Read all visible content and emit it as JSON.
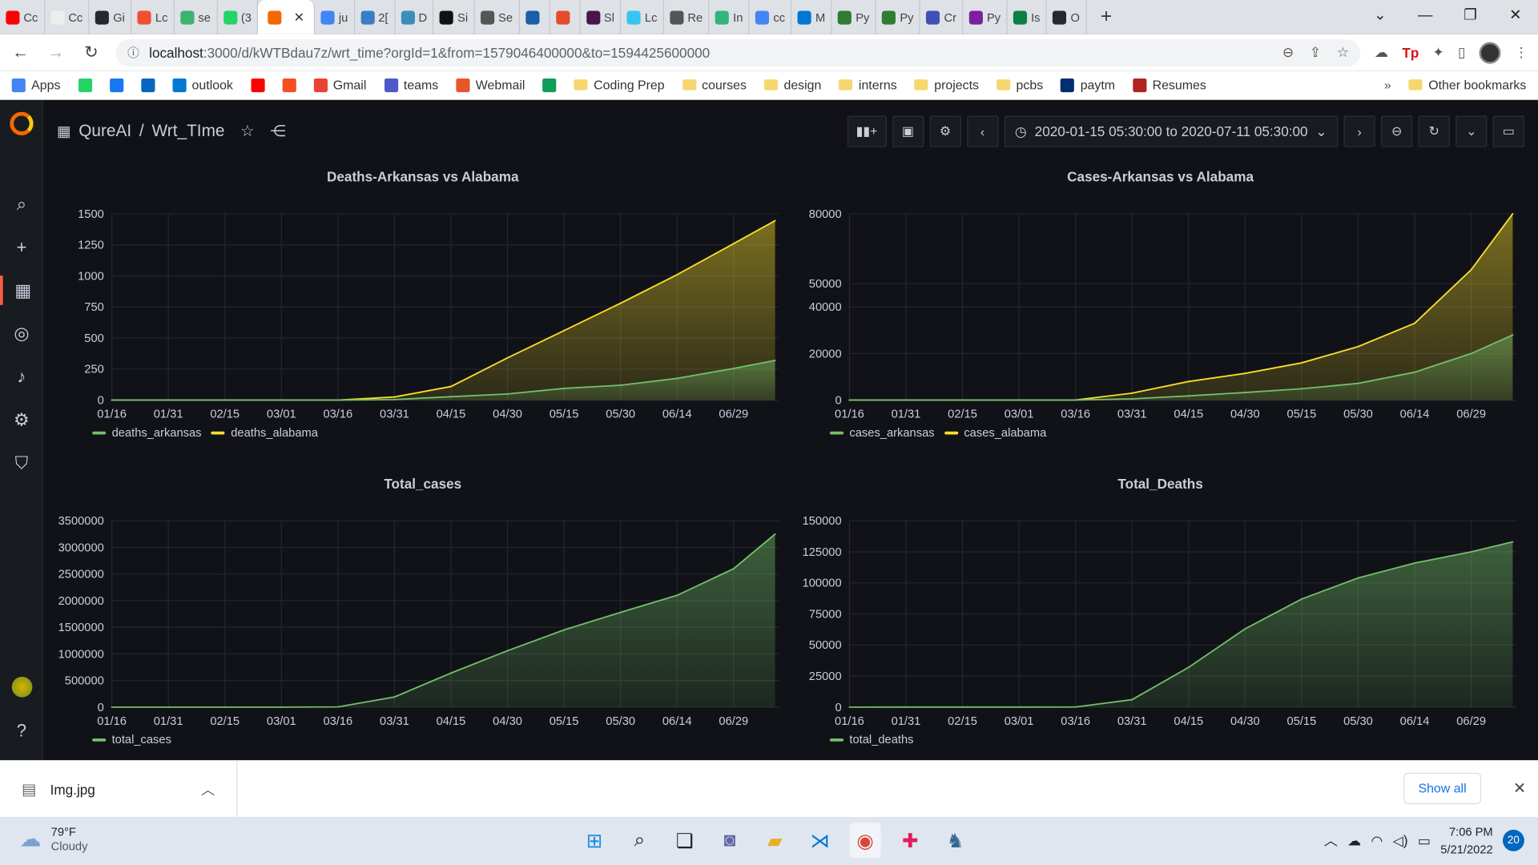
{
  "browser": {
    "tabs": [
      {
        "label": "Cc",
        "color": "#ff0000"
      },
      {
        "label": "Cc",
        "color": "#eeeeee"
      },
      {
        "label": "Gi",
        "color": "#24292e"
      },
      {
        "label": "Lc",
        "color": "#f05032"
      },
      {
        "label": "se",
        "color": "#3cb371"
      },
      {
        "label": "(3",
        "color": "#25d366"
      },
      {
        "label": "",
        "color": "#f46800",
        "active": true
      },
      {
        "label": "ju",
        "color": "#4285f4"
      },
      {
        "label": "2[",
        "color": "#3b7dc4"
      },
      {
        "label": "D",
        "color": "#3c8dbc"
      },
      {
        "label": "Si",
        "color": "#111111"
      },
      {
        "label": "Se",
        "color": "#555555"
      },
      {
        "label": "",
        "color": "#1a5da8"
      },
      {
        "label": "",
        "color": "#e54b2a"
      },
      {
        "label": "Sl",
        "color": "#4a154b"
      },
      {
        "label": "Lc",
        "color": "#36c5f0"
      },
      {
        "label": "Re",
        "color": "#555555"
      },
      {
        "label": "In",
        "color": "#2eb67d"
      },
      {
        "label": "cc",
        "color": "#4285f4"
      },
      {
        "label": "M",
        "color": "#0078d4"
      },
      {
        "label": "Py",
        "color": "#2e7d32"
      },
      {
        "label": "Py",
        "color": "#2e7d32"
      },
      {
        "label": "Cr",
        "color": "#3f51b5"
      },
      {
        "label": "Py",
        "color": "#7b1fa2"
      },
      {
        "label": "Is",
        "color": "#0b8043"
      },
      {
        "label": "O",
        "color": "#24292e"
      }
    ],
    "url_host": "localhost",
    "url_rest": ":3000/d/kWTBdau7z/wrt_time?orgId=1&from=1579046400000&to=1594425600000"
  },
  "bookmarks": [
    {
      "label": "Apps",
      "icon": "apps-grid",
      "color": "#4285f4"
    },
    {
      "label": "",
      "icon": "whatsapp",
      "color": "#25d366"
    },
    {
      "label": "",
      "icon": "facebook",
      "color": "#1877f2"
    },
    {
      "label": "",
      "icon": "linkedin",
      "color": "#0a66c2"
    },
    {
      "label": "outlook",
      "icon": "outlook",
      "color": "#0078d4"
    },
    {
      "label": "",
      "icon": "youtube",
      "color": "#ff0000"
    },
    {
      "label": "",
      "icon": "microsoft",
      "color": "#f25022"
    },
    {
      "label": "Gmail",
      "icon": "gmail",
      "color": "#ea4335"
    },
    {
      "label": "teams",
      "icon": "teams",
      "color": "#5059c9"
    },
    {
      "label": "Webmail",
      "icon": "webmail",
      "color": "#e8572a"
    },
    {
      "label": "",
      "icon": "drive",
      "color": "#0f9d58"
    },
    {
      "label": "Coding Prep",
      "icon": "folder"
    },
    {
      "label": "courses",
      "icon": "folder"
    },
    {
      "label": "design",
      "icon": "folder"
    },
    {
      "label": "interns",
      "icon": "folder"
    },
    {
      "label": "projects",
      "icon": "folder"
    },
    {
      "label": "pcbs",
      "icon": "folder"
    },
    {
      "label": "paytm",
      "icon": "paytm",
      "color": "#002e6e"
    },
    {
      "label": "Resumes",
      "icon": "resumes",
      "color": "#b22222"
    }
  ],
  "bookmarks_more": "»",
  "other_bookmarks": "Other bookmarks",
  "grafana": {
    "org": "QureAI",
    "separator": "/",
    "dashboard": "Wrt_TIme",
    "time_range": "2020-01-15 05:30:00 to 2020-07-11 05:30:00"
  },
  "x_ticks": [
    "01/16",
    "01/31",
    "02/15",
    "03/01",
    "03/16",
    "03/31",
    "04/15",
    "04/30",
    "05/15",
    "05/30",
    "06/14",
    "06/29"
  ],
  "chart_data": [
    {
      "type": "area",
      "title": "Deaths-Arkansas vs Alabama",
      "x_start": "01/16",
      "x_end": "07/11",
      "ylim": [
        0,
        1500
      ],
      "y_ticks": [
        0,
        250,
        500,
        750,
        1000,
        1250,
        1500
      ],
      "stacked": true,
      "legend_placement": "bottom-left",
      "series": [
        {
          "name": "deaths_arkansas",
          "color": "#73bf69",
          "points": [
            [
              "01/16",
              0
            ],
            [
              "03/16",
              0
            ],
            [
              "03/31",
              5
            ],
            [
              "04/15",
              28
            ],
            [
              "04/30",
              50
            ],
            [
              "05/15",
              95
            ],
            [
              "05/30",
              120
            ],
            [
              "06/14",
              175
            ],
            [
              "06/29",
              255
            ],
            [
              "07/10",
              320
            ]
          ]
        },
        {
          "name": "deaths_alabama",
          "color": "#fade2a",
          "points": [
            [
              "01/16",
              0
            ],
            [
              "03/16",
              0
            ],
            [
              "03/31",
              25
            ],
            [
              "04/15",
              110
            ],
            [
              "04/30",
              340
            ],
            [
              "05/15",
              560
            ],
            [
              "05/30",
              780
            ],
            [
              "06/14",
              1010
            ],
            [
              "06/29",
              1260
            ],
            [
              "07/10",
              1445
            ]
          ]
        }
      ]
    },
    {
      "type": "area",
      "title": "Cases-Arkansas vs Alabama",
      "x_start": "01/16",
      "x_end": "07/11",
      "ylim": [
        0,
        80000
      ],
      "y_ticks": [
        0,
        20000,
        40000,
        50000,
        80000
      ],
      "stacked": true,
      "legend_placement": "bottom-left",
      "series": [
        {
          "name": "cases_arkansas",
          "color": "#73bf69",
          "points": [
            [
              "01/16",
              0
            ],
            [
              "03/16",
              30
            ],
            [
              "03/31",
              550
            ],
            [
              "04/15",
              1800
            ],
            [
              "04/30",
              3300
            ],
            [
              "05/15",
              4900
            ],
            [
              "05/30",
              7200
            ],
            [
              "06/14",
              12000
            ],
            [
              "06/29",
              20000
            ],
            [
              "07/10",
              28000
            ]
          ]
        },
        {
          "name": "cases_alabama",
          "color": "#fade2a",
          "points": [
            [
              "01/16",
              0
            ],
            [
              "03/16",
              50
            ],
            [
              "03/31",
              3000
            ],
            [
              "04/15",
              8000
            ],
            [
              "04/30",
              11500
            ],
            [
              "05/15",
              16000
            ],
            [
              "05/30",
              23000
            ],
            [
              "06/14",
              33000
            ],
            [
              "06/29",
              56000
            ],
            [
              "07/10",
              80000
            ]
          ]
        }
      ]
    },
    {
      "type": "area",
      "title": "Total_cases",
      "x_start": "01/16",
      "x_end": "07/11",
      "ylim": [
        0,
        3500000
      ],
      "y_ticks": [
        0,
        500000,
        1000000,
        1500000,
        2000000,
        2500000,
        3000000,
        3500000
      ],
      "stacked": false,
      "legend_placement": "bottom-left",
      "series": [
        {
          "name": "total_cases",
          "color": "#73bf69",
          "points": [
            [
              "01/16",
              0
            ],
            [
              "03/01",
              80
            ],
            [
              "03/16",
              4000
            ],
            [
              "03/31",
              190000
            ],
            [
              "04/15",
              640000
            ],
            [
              "04/30",
              1060000
            ],
            [
              "05/15",
              1450000
            ],
            [
              "05/30",
              1780000
            ],
            [
              "06/14",
              2100000
            ],
            [
              "06/29",
              2600000
            ],
            [
              "07/10",
              3250000
            ]
          ]
        }
      ]
    },
    {
      "type": "area",
      "title": "Total_Deaths",
      "x_start": "01/16",
      "x_end": "07/11",
      "ylim": [
        0,
        150000
      ],
      "y_ticks": [
        0,
        25000,
        50000,
        75000,
        100000,
        125000,
        150000
      ],
      "stacked": false,
      "legend_placement": "bottom-left",
      "series": [
        {
          "name": "total_deaths",
          "color": "#73bf69",
          "points": [
            [
              "01/16",
              0
            ],
            [
              "03/16",
              80
            ],
            [
              "03/31",
              6000
            ],
            [
              "04/15",
              32000
            ],
            [
              "04/30",
              63000
            ],
            [
              "05/15",
              87000
            ],
            [
              "05/30",
              104000
            ],
            [
              "06/14",
              116000
            ],
            [
              "06/29",
              125000
            ],
            [
              "07/10",
              133000
            ]
          ]
        }
      ]
    }
  ],
  "download": {
    "file": "Img.jpg",
    "show_all": "Show all"
  },
  "taskbar": {
    "temp": "79°F",
    "condition": "Cloudy",
    "time": "7:06 PM",
    "date": "5/21/2022",
    "notifications": "20"
  }
}
